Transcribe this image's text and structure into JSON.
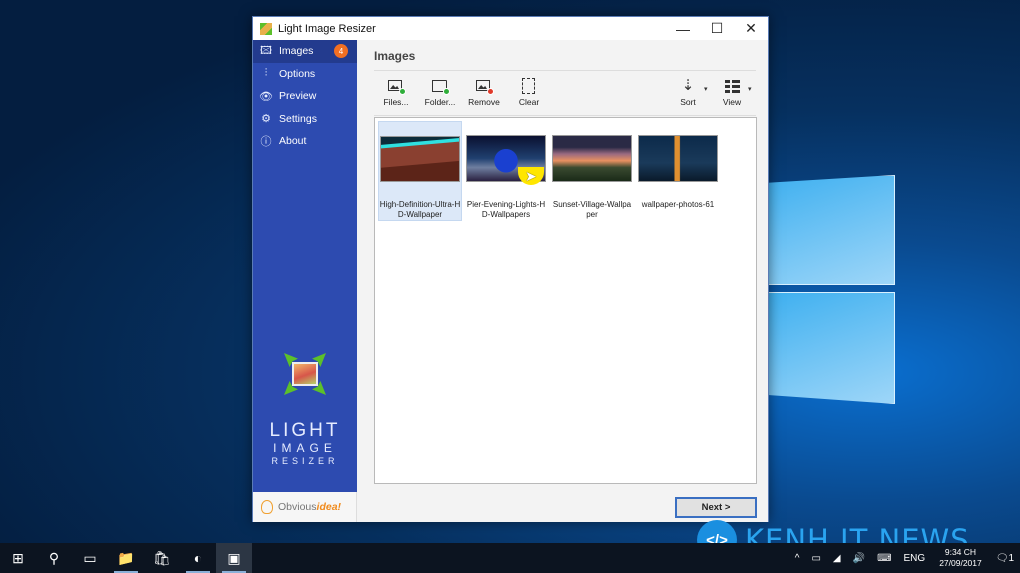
{
  "window": {
    "title": "Light Image Resizer",
    "controls": {
      "minimize": "—",
      "maximize": "☐",
      "close": "✕"
    }
  },
  "sidebar": {
    "items": [
      {
        "label": "Images",
        "icon": "images-icon",
        "glyph": "🖾",
        "badge": "4",
        "active": true
      },
      {
        "label": "Options",
        "icon": "sliders-icon",
        "glyph": "⫶"
      },
      {
        "label": "Preview",
        "icon": "eye-icon",
        "glyph": "👁"
      },
      {
        "label": "Settings",
        "icon": "gear-icon",
        "glyph": "⚙"
      },
      {
        "label": "About",
        "icon": "info-icon",
        "glyph": "ⓘ"
      }
    ],
    "logo": {
      "line1": "LIGHT",
      "line2": "IMAGE",
      "line3": "RESIZER"
    },
    "brand": {
      "part1": "Obvious",
      "part2": "idea!"
    }
  },
  "main": {
    "title": "Images",
    "toolbar": {
      "files": "Files...",
      "folder": "Folder...",
      "remove": "Remove",
      "clear": "Clear",
      "sort": "Sort",
      "view": "View",
      "sort_glyph": "⇣",
      "caret": "▾"
    },
    "images": [
      {
        "name": "High-Definition-Ultra-HD-Wallpaper",
        "selected": true
      },
      {
        "name": "Pier-Evening-Lights-HD-Wallpapers",
        "selected": false
      },
      {
        "name": "Sunset-Village-Wallpaper",
        "selected": false
      },
      {
        "name": "wallpaper-photos-61",
        "selected": false
      }
    ],
    "next_button": "Next >"
  },
  "watermark": {
    "logo": "</>",
    "text": "KENH IT NEWS"
  },
  "taskbar": {
    "apps": [
      {
        "name": "start",
        "glyph": "⊞"
      },
      {
        "name": "search",
        "glyph": "⚲"
      },
      {
        "name": "task-view",
        "glyph": "▭"
      },
      {
        "name": "file-explorer",
        "glyph": "📁"
      },
      {
        "name": "store",
        "glyph": "🛍"
      },
      {
        "name": "app-green",
        "glyph": "◐"
      },
      {
        "name": "light-image-resizer",
        "glyph": "▣"
      }
    ],
    "tray": {
      "chevron": "^",
      "battery": "▭",
      "wifi": "◢",
      "volume": "🔊",
      "keyboard": "⌨",
      "language": "ENG",
      "time": "9:34 CH",
      "date": "27/09/2017",
      "notifications": "1"
    }
  },
  "colors": {
    "sidebar": "#2d4bb0",
    "badge": "#f26f22",
    "accent": "#3a6fc2"
  }
}
